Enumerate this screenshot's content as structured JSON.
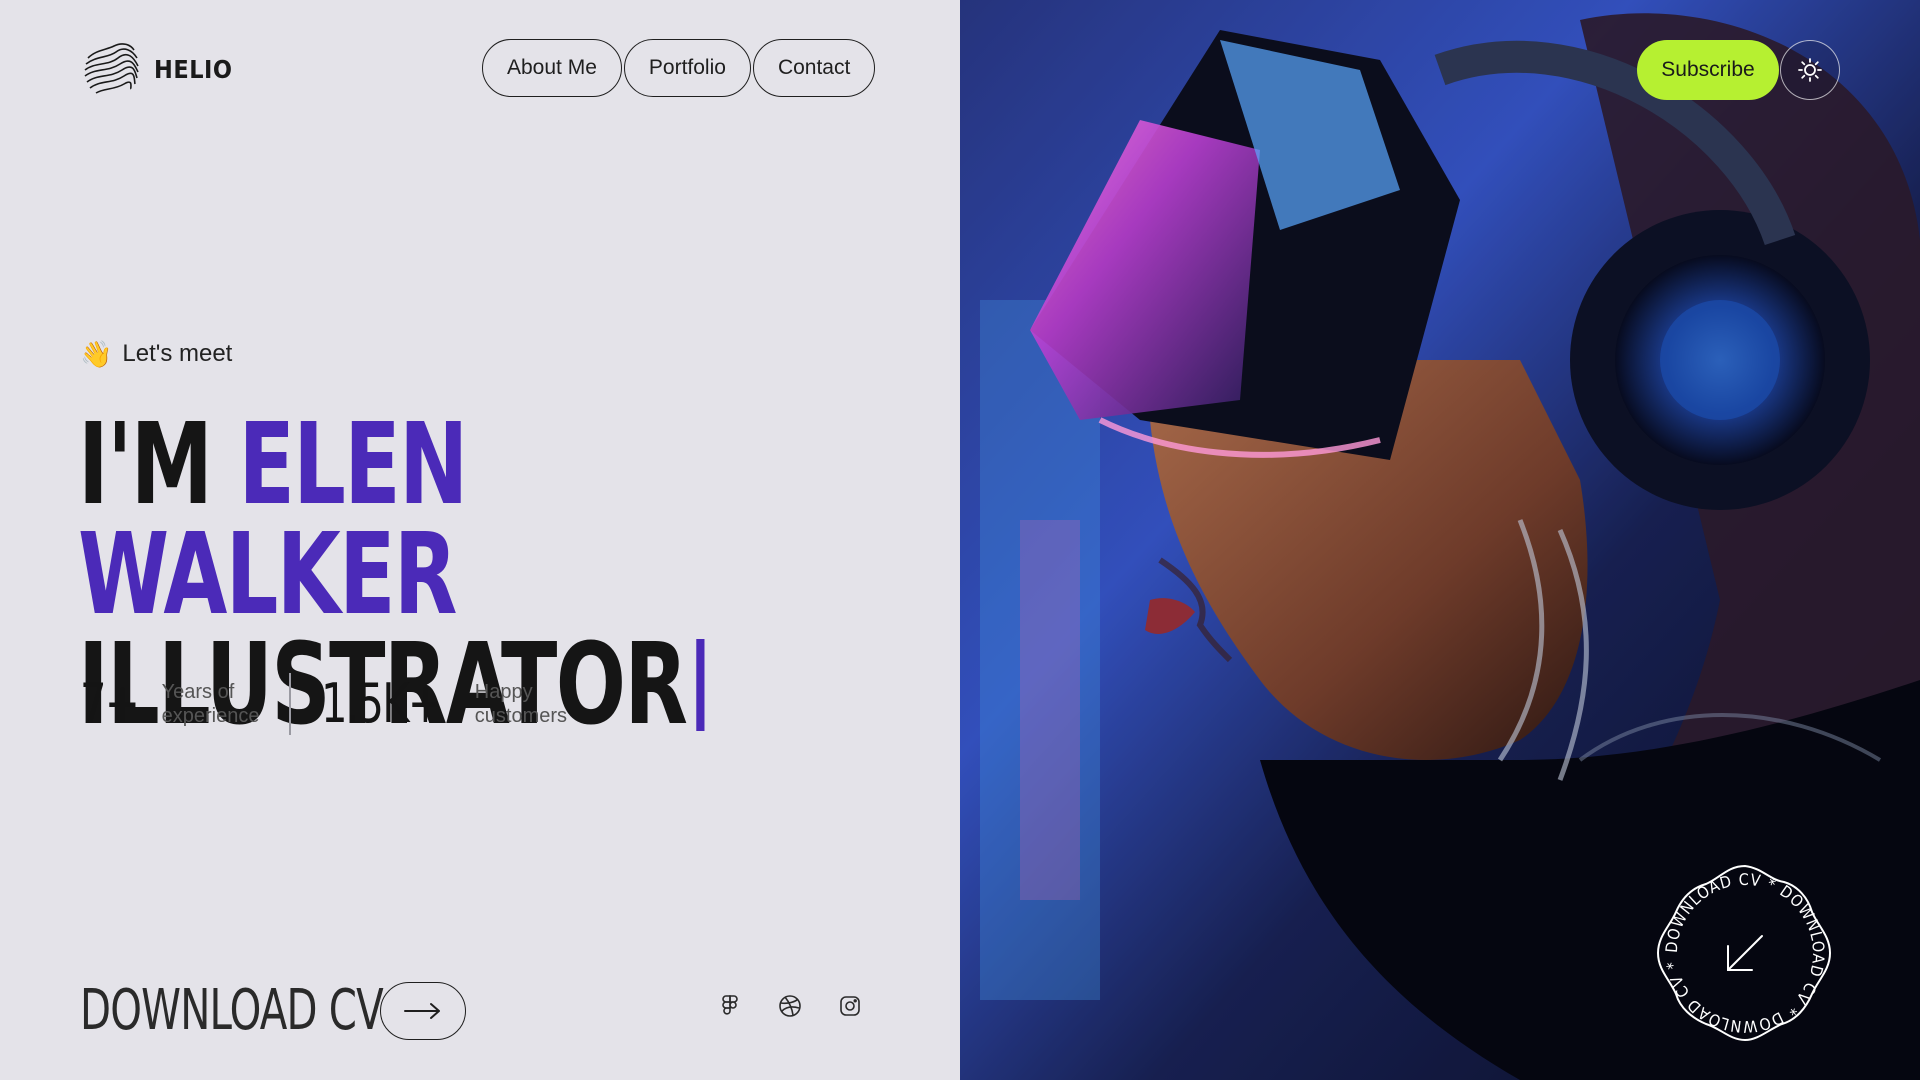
{
  "brand": {
    "name": "HELIO"
  },
  "nav": {
    "items": [
      "About Me",
      "Portfolio",
      "Contact"
    ]
  },
  "header": {
    "subscribe_label": "Subscribe",
    "theme_icon": "sun-icon"
  },
  "hero": {
    "greeting": "Let's meet",
    "greeting_icon": "waving-hand-icon",
    "prefix": "I'M",
    "name": "ELEN WALKER",
    "role": "ILLUSTRATOR"
  },
  "stats": [
    {
      "value": "7+",
      "label_line1": "Years of",
      "label_line2": "experience"
    },
    {
      "value": "1.5K+",
      "label_line1": "Happy",
      "label_line2": "customers"
    }
  ],
  "download": {
    "label": "DOWNLOAD CV",
    "icon": "arrow-right-icon"
  },
  "social": [
    "figma-icon",
    "dribbble-icon",
    "instagram-icon"
  ],
  "badge": {
    "text": "DOWNLOAD CV * DOWNLOAD CV * DOWNLOAD CV *",
    "icon": "arrow-down-left-icon"
  },
  "colors": {
    "accent": "#4b2ab8",
    "subscribe": "#b6f031",
    "background": "#e4e3e9"
  }
}
